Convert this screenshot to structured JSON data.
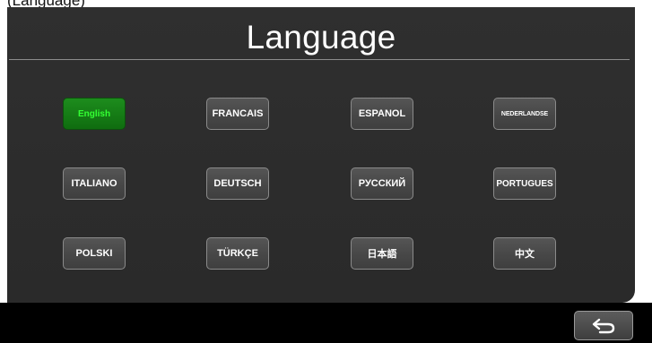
{
  "header_caption": "(Language)",
  "title": "Language",
  "languages": [
    {
      "label": "English",
      "selected": true
    },
    {
      "label": "FRANCAIS",
      "selected": false
    },
    {
      "label": "ESPANOL",
      "selected": false
    },
    {
      "label": "NEDERLANDSE",
      "selected": false
    },
    {
      "label": "ITALIANO",
      "selected": false
    },
    {
      "label": "DEUTSCH",
      "selected": false
    },
    {
      "label": "РУССКИЙ",
      "selected": false
    },
    {
      "label": "PORTUGUES",
      "selected": false
    },
    {
      "label": "POLSKI",
      "selected": false
    },
    {
      "label": "TÜRKÇE",
      "selected": false
    },
    {
      "label": "日本語",
      "selected": false
    },
    {
      "label": "中文",
      "selected": false
    }
  ],
  "back_icon": "return-arrow-icon",
  "colors": {
    "panel": "#2f2f2f",
    "selected_bg": "#137a13",
    "selected_text": "#33ff33",
    "button_bg": "#4a4a4a",
    "text": "#ffffff"
  }
}
